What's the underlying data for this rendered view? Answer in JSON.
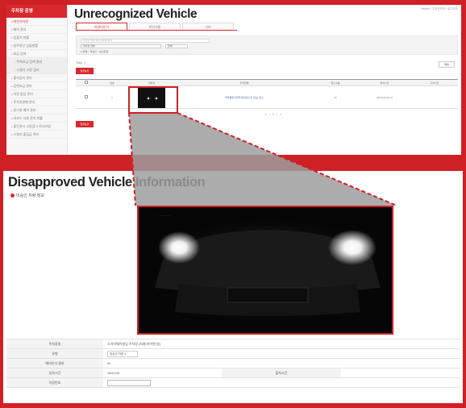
{
  "top": {
    "sidebar": {
      "header": "주차장 운영",
      "items": [
        {
          "label": "• 미인식차량",
          "active": true,
          "sub": false
        },
        {
          "label": "• 예약 관리",
          "sub": false
        },
        {
          "label": "• 입출차 현황",
          "sub": false
        },
        {
          "label": "• 실주정산 입출현황",
          "sub": false
        },
        {
          "label": "• 요금 검색",
          "sub": false
        },
        {
          "label": "- 주차요금 검색 결과",
          "sub": true
        },
        {
          "label": "- 시설사 고장 검사",
          "sub": true
        },
        {
          "label": "• 출차감지 관리",
          "sub": false
        },
        {
          "label": "• 감면요금 관리",
          "sub": false
        },
        {
          "label": "• 차량 출입 관리",
          "sub": false
        },
        {
          "label": "• 주차권판매 관리",
          "sub": false
        },
        {
          "label": "• 정기권 예약 관리",
          "sub": false
        },
        {
          "label": "• 바코드 사용 관리 현황",
          "sub": false
        },
        {
          "label": "• 할인권사 고장감시 모니터링",
          "sub": false
        },
        {
          "label": "• 스윗지 출입금 관리",
          "sub": false
        }
      ]
    },
    "title": "Unrecognized Vehicle",
    "user_info": "Hanam / 주차관리자 / 로그아웃",
    "tabs": [
      "차량미인식",
      "미인식통",
      "기타"
    ],
    "filter": {
      "search_placeholder": "주차장 명칭 미인식차량 검색",
      "select1": "주차장 전체",
      "select2": "전체",
      "radios": "● 전체  ○ 미승인  ○ 승인완료"
    },
    "total_label": "Total : 1",
    "approve_button": "일괄승인",
    "approve_button_bottom": "일괄승인",
    "excel_button": "엑셀",
    "table": {
      "headers": [
        "□",
        "번호",
        "이미지",
        "주차장명",
        "입출구분",
        "입차시간",
        "출차시간"
      ],
      "row": {
        "no": "1",
        "lot": "세무통합사회주차장(입출차 정보) 입출",
        "gate": "IN",
        "entry_time": "18/11/20 22:14",
        "exit_time": ""
      }
    },
    "pager": "« ‹ 1 › »"
  },
  "bottom": {
    "title": "Disapproved Vehicle Information",
    "subtitle": "미승인 차량 정보",
    "details": {
      "lot_label": "주차장명",
      "lot_value": "스카이웨이빌딩 주차장 (지층/하이렌 밑)",
      "type_label": "유형",
      "type_value": "미승인 차량 ∨",
      "result_label": "예비인식 결과",
      "result_value": "IN",
      "entry_label": "입차시간",
      "entry_value": "18/11/20",
      "exit_label": "출차시간",
      "exit_value": "",
      "plate_label": "차량번호",
      "plate_value": ""
    }
  },
  "colors": {
    "accent": "#cf2026",
    "link": "#4a5fb8"
  }
}
